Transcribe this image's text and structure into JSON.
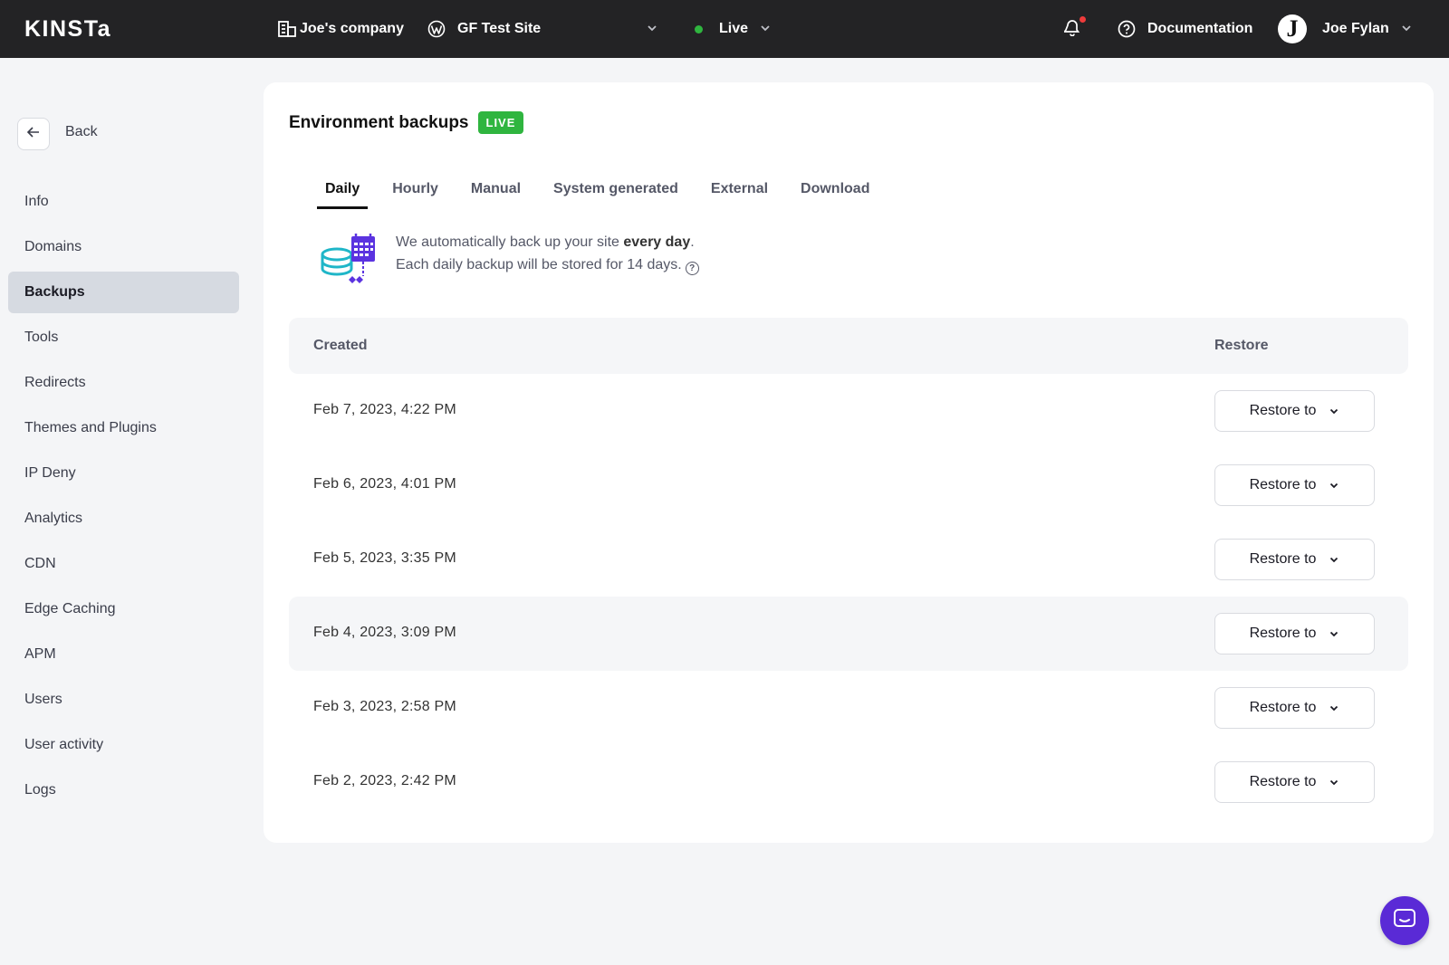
{
  "brand": {
    "logo_text": "KINSTa"
  },
  "topbar": {
    "company": "Joe's company",
    "site": "GF Test Site",
    "environment": "Live",
    "documentation": "Documentation",
    "user_name": "Joe Fylan",
    "avatar_letter": "J"
  },
  "sidebar": {
    "back_label": "Back",
    "items": [
      {
        "label": "Info"
      },
      {
        "label": "Domains"
      },
      {
        "label": "Backups",
        "active": true
      },
      {
        "label": "Tools"
      },
      {
        "label": "Redirects"
      },
      {
        "label": "Themes and Plugins"
      },
      {
        "label": "IP Deny"
      },
      {
        "label": "Analytics"
      },
      {
        "label": "CDN"
      },
      {
        "label": "Edge Caching"
      },
      {
        "label": "APM"
      },
      {
        "label": "Users"
      },
      {
        "label": "User activity"
      },
      {
        "label": "Logs"
      }
    ]
  },
  "main": {
    "title": "Environment backups",
    "badge": "LIVE",
    "tabs": [
      {
        "label": "Daily",
        "active": true
      },
      {
        "label": "Hourly"
      },
      {
        "label": "Manual"
      },
      {
        "label": "System generated"
      },
      {
        "label": "External"
      },
      {
        "label": "Download"
      }
    ],
    "info_line1_prefix": "We automatically back up your site ",
    "info_line1_bold": "every day",
    "info_line1_suffix": ".",
    "info_line2": "Each daily backup will be stored for 14 days.",
    "table": {
      "col_created": "Created",
      "col_restore": "Restore",
      "restore_button_label": "Restore to",
      "rows": [
        {
          "created": "Feb 7, 2023, 4:22 PM"
        },
        {
          "created": "Feb 6, 2023, 4:01 PM"
        },
        {
          "created": "Feb 5, 2023, 3:35 PM"
        },
        {
          "created": "Feb 4, 2023, 3:09 PM",
          "hovered": true
        },
        {
          "created": "Feb 3, 2023, 2:58 PM"
        },
        {
          "created": "Feb 2, 2023, 2:42 PM"
        }
      ]
    }
  },
  "colors": {
    "topbar_bg": "#232325",
    "live_green": "#2fb53f",
    "chat_purple": "#5a2ad6",
    "notification_red": "#ee3b3b"
  },
  "icons": {
    "company": "building-icon",
    "site": "wordpress-icon",
    "bell": "bell-icon",
    "docs": "help-circle-icon",
    "back": "arrow-left-icon",
    "chat": "chat-icon"
  }
}
